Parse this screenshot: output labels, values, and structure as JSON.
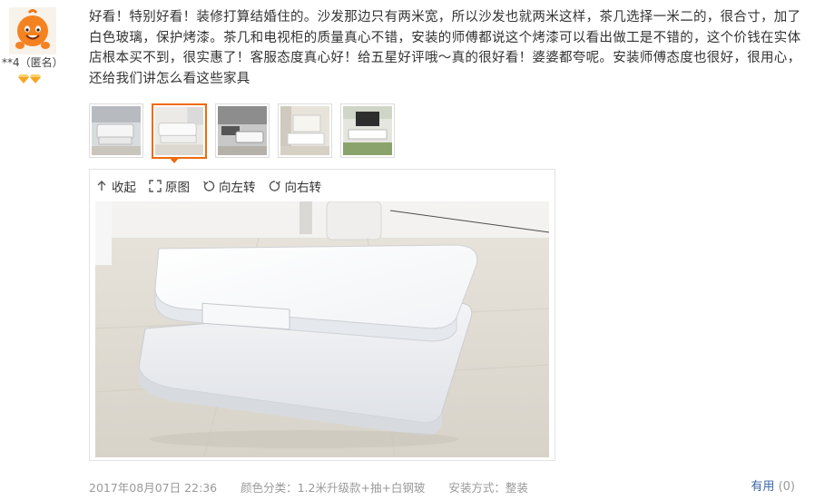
{
  "user": {
    "name": "**4（匿名）",
    "avatar_icon": "orange-mascot-avatar-icon",
    "badge_icon": "diamond-level-badge-icon"
  },
  "review": {
    "text": "好看！特别好看！装修打算结婚住的。沙发那边只有两米宽，所以沙发也就两米这样，茶几选择一米二的，很合寸，加了白色玻璃，保护烤漆。茶几和电视柜的质量真心不错，安装的师傅都说这个烤漆可以看出做工是不错的，这个价钱在实体店根本买不到，很实惠了！客服态度真心好！给五星好评哦～真的很好看！婆婆都夸呢。安装师傅态度也很好，很用心，还给我们讲怎么看这些家具"
  },
  "thumbnails": [
    {
      "name": "thumb-1",
      "selected": false
    },
    {
      "name": "thumb-2",
      "selected": true
    },
    {
      "name": "thumb-3",
      "selected": false
    },
    {
      "name": "thumb-4",
      "selected": false
    },
    {
      "name": "thumb-5",
      "selected": false
    }
  ],
  "toolbar": {
    "collapse_label": "收起",
    "original_label": "原图",
    "rotate_left_label": "向左转",
    "rotate_right_label": "向右转"
  },
  "meta": {
    "date": "2017年08月07日 22:36",
    "color_category": "颜色分类：1.2米升级款+抽+白钢玻",
    "install_method": "安装方式：整装"
  },
  "useful": {
    "label": "有用",
    "count": "(0)"
  },
  "colors": {
    "accent": "#f0690c",
    "link": "#3a66a8",
    "meta_text": "#999999"
  }
}
